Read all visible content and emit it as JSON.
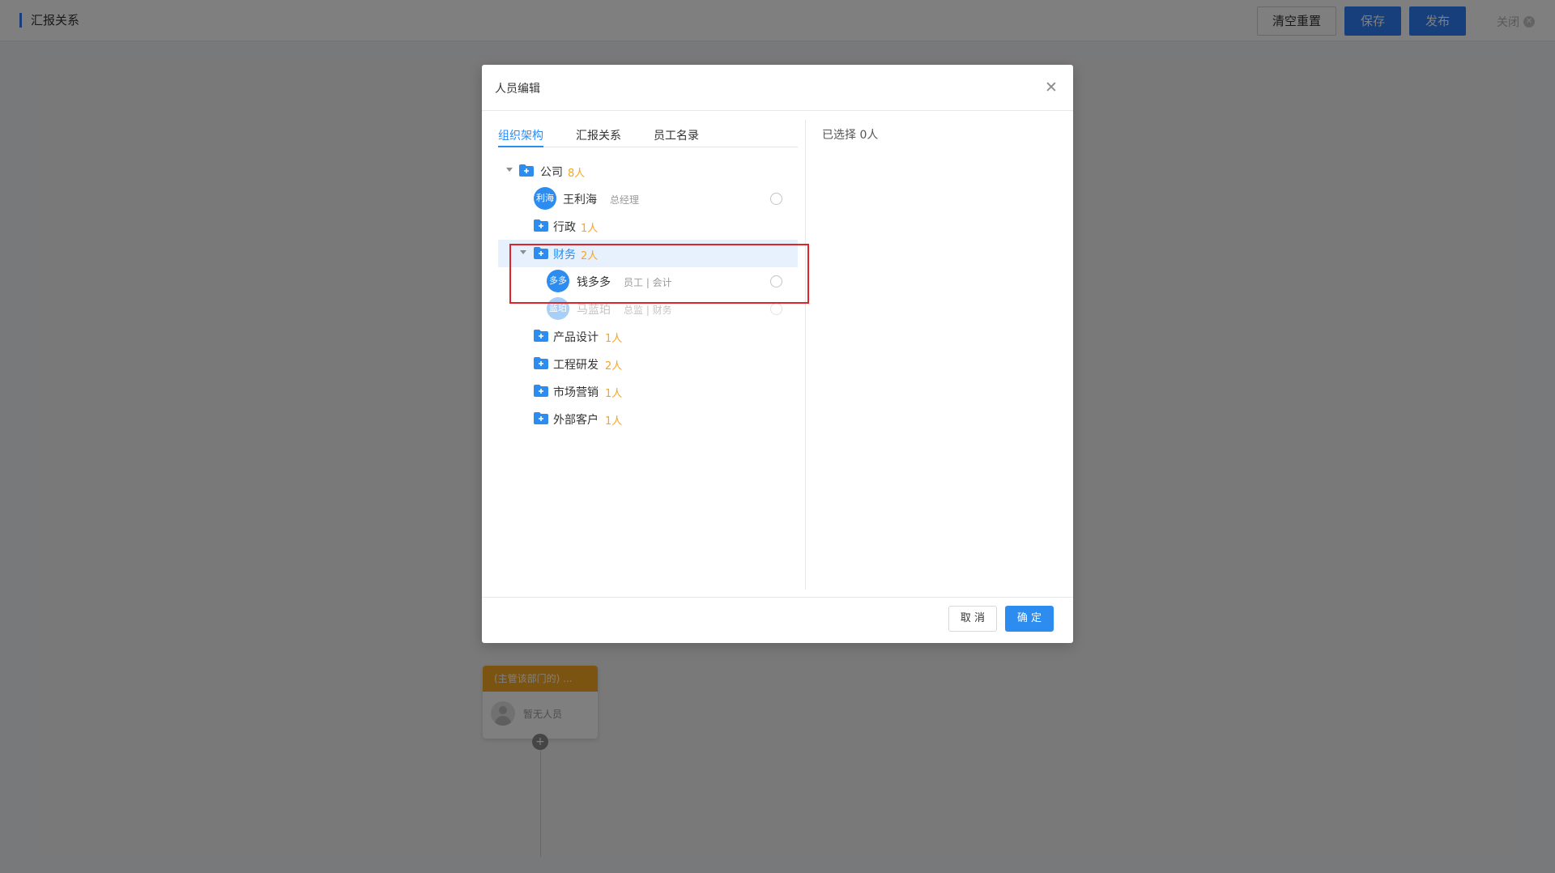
{
  "topbar": {
    "title": "汇报关系",
    "clear_label": "清空重置",
    "save_label": "保存",
    "publish_label": "发布",
    "close_label": "关闭"
  },
  "flow": {
    "node_header": "(主管该部门的) ...",
    "node_empty": "暂无人员"
  },
  "dialog": {
    "title": "人员编辑",
    "tabs": [
      "组织架构",
      "汇报关系",
      "员工名录"
    ],
    "active_tab": "组织架构",
    "selected_text": "已选择 0人",
    "cancel_label": "取 消",
    "ok_label": "确 定",
    "tree": [
      {
        "type": "dept",
        "name": "公司",
        "count": "8人",
        "expanded": true
      },
      {
        "type": "person",
        "avatar": "利海",
        "name": "王利海",
        "title": "总经理"
      },
      {
        "type": "dept",
        "name": "行政",
        "count": "1人"
      },
      {
        "type": "dept",
        "name": "财务",
        "count": "2人",
        "expanded": true,
        "highlighted": true
      },
      {
        "type": "person",
        "avatar": "多多",
        "name": "钱多多",
        "title": "员工 | 会计"
      },
      {
        "type": "person",
        "avatar": "蓝珀",
        "name": "马蓝珀",
        "title": "总监 | 财务",
        "disabled": true
      },
      {
        "type": "dept",
        "name": "产品设计",
        "count": "1人"
      },
      {
        "type": "dept",
        "name": "工程研发",
        "count": "2人"
      },
      {
        "type": "dept",
        "name": "市场营销",
        "count": "1人"
      },
      {
        "type": "dept",
        "name": "外部客户",
        "count": "1人"
      }
    ]
  },
  "colors": {
    "primary": "#2d8cf0",
    "count": "#f5a623",
    "highlight_box": "#e0242b",
    "node_header": "#f9a825"
  }
}
